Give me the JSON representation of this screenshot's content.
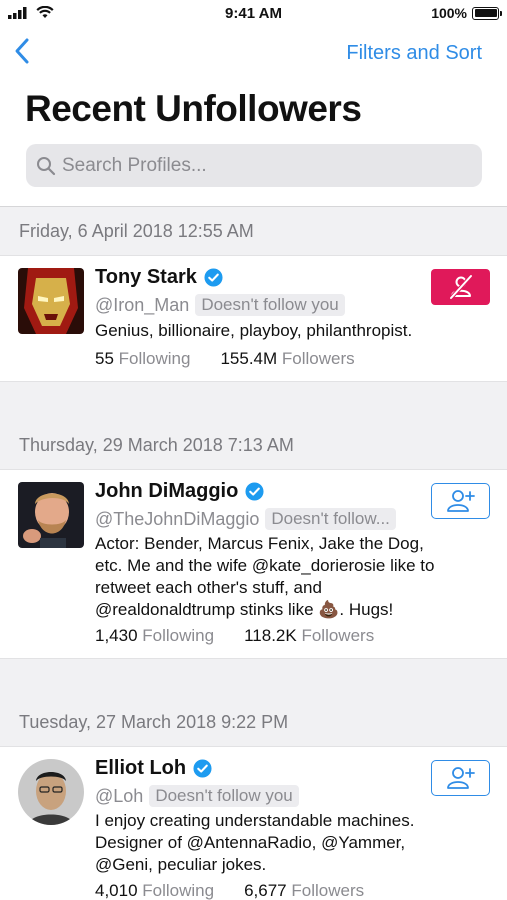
{
  "status_bar": {
    "time": "9:41 AM",
    "battery": "100%",
    "icons": [
      "signal-icon",
      "wifi-icon",
      "battery-icon"
    ]
  },
  "nav": {
    "back_icon": "chevron-left-icon",
    "filters_label": "Filters and Sort"
  },
  "title": "Recent Unfollowers",
  "search": {
    "placeholder": "Search Profiles..."
  },
  "colors": {
    "accent": "#2f8ce6",
    "unfollow": "#e0195a",
    "verified": "#1d9bf0",
    "section_bg": "#f1f1f3"
  },
  "sections": [
    {
      "date": "Friday, 6 April 2018 12:55 AM",
      "profile": {
        "name": "Tony Stark",
        "verified": true,
        "handle": "@Iron_Man",
        "relation": "Doesn't follow you",
        "bio": "Genius, billionaire, playboy, philanthropist.",
        "following_count": "55",
        "following_label": "Following",
        "followers_count": "155.4M",
        "followers_label": "Followers",
        "action": "unfollow-icon"
      }
    },
    {
      "date": "Thursday, 29 March 2018 7:13 AM",
      "profile": {
        "name": "John DiMaggio",
        "verified": true,
        "handle": "@TheJohnDiMaggio",
        "relation": "Doesn't follow...",
        "bio_lines": [
          "Actor: Bender, Marcus Fenix, Jake the Dog,",
          "etc. Me and the wife @kate_dorierosie like to",
          "retweet each other's stuff, and",
          "@realdonaldtrump stinks like 💩. Hugs!"
        ],
        "following_count": "1,430",
        "following_label": "Following",
        "followers_count": "118.2K",
        "followers_label": "Followers",
        "action": "add-user-icon"
      }
    },
    {
      "date": "Tuesday, 27 March 2018 9:22 PM",
      "profile": {
        "name": "Elliot Loh",
        "verified": true,
        "handle": "@Loh",
        "relation": "Doesn't follow you",
        "bio_lines": [
          "I enjoy creating understandable machines.",
          "Designer of @AntennaRadio, @Yammer,",
          "@Geni, peculiar jokes."
        ],
        "following_count": "4,010",
        "following_label": "Following",
        "followers_count": "6,677",
        "followers_label": "Followers",
        "action": "add-user-icon"
      }
    }
  ]
}
